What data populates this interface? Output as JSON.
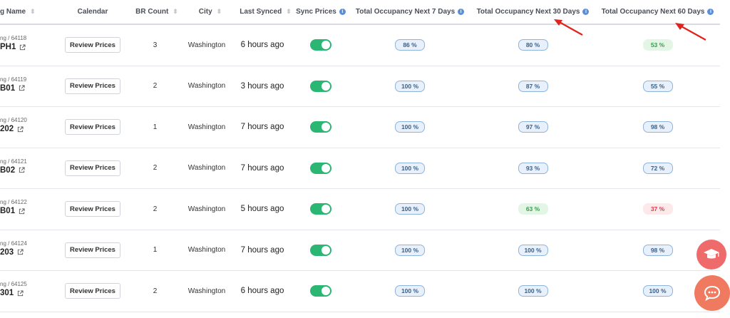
{
  "header": {
    "name": "g Name",
    "calendar": "Calendar",
    "br_count": "BR Count",
    "city": "City",
    "last_synced": "Last Synced",
    "sync_prices": "Sync Prices",
    "occ7": "Total Occupancy Next 7 Days",
    "occ30": "Total Occupancy Next 30 Days",
    "occ60": "Total Occupancy Next 60 Days"
  },
  "review_label": "Review Prices",
  "rows": [
    {
      "sub": "ng / 64118",
      "name": "PH1",
      "br": "3",
      "city": "Washington",
      "synced": "6 hours ago",
      "occ7": "86 %",
      "occ7_tone": "blue",
      "occ30": "80 %",
      "occ30_tone": "blue",
      "occ60": "53 %",
      "occ60_tone": "green"
    },
    {
      "sub": "ng / 64119",
      "name": "B01",
      "br": "2",
      "city": "Washington",
      "synced": "3 hours ago",
      "occ7": "100 %",
      "occ7_tone": "blue",
      "occ30": "87 %",
      "occ30_tone": "blue",
      "occ60": "55 %",
      "occ60_tone": "blue"
    },
    {
      "sub": "ng / 64120",
      "name": "202",
      "br": "1",
      "city": "Washington",
      "synced": "7 hours ago",
      "occ7": "100 %",
      "occ7_tone": "blue",
      "occ30": "97 %",
      "occ30_tone": "blue",
      "occ60": "98 %",
      "occ60_tone": "blue"
    },
    {
      "sub": "ng / 64121",
      "name": "B02",
      "br": "2",
      "city": "Washington",
      "synced": "7 hours ago",
      "occ7": "100 %",
      "occ7_tone": "blue",
      "occ30": "93 %",
      "occ30_tone": "blue",
      "occ60": "72 %",
      "occ60_tone": "blue"
    },
    {
      "sub": "ng / 64122",
      "name": "B01",
      "br": "2",
      "city": "Washington",
      "synced": "5 hours ago",
      "occ7": "100 %",
      "occ7_tone": "blue",
      "occ30": "63 %",
      "occ30_tone": "green",
      "occ60": "37 %",
      "occ60_tone": "red"
    },
    {
      "sub": "ng / 64124",
      "name": "203",
      "br": "1",
      "city": "Washington",
      "synced": "7 hours ago",
      "occ7": "100 %",
      "occ7_tone": "blue",
      "occ30": "100 %",
      "occ30_tone": "blue",
      "occ60": "98 %",
      "occ60_tone": "blue"
    },
    {
      "sub": "ng / 64125",
      "name": "301",
      "br": "2",
      "city": "Washington",
      "synced": "6 hours ago",
      "occ7": "100 %",
      "occ7_tone": "blue",
      "occ30": "100 %",
      "occ30_tone": "blue",
      "occ60": "100 %",
      "occ60_tone": "blue"
    }
  ],
  "colors": {
    "toggle_on": "#2bb673",
    "fab_academy": "#ef6b6b",
    "fab_chat": "#f07a5f",
    "annotation_arrow": "#e0231c"
  },
  "icons": [
    "external-link-icon",
    "sort-icon",
    "info-icon",
    "graduation-cap-icon",
    "chat-icon",
    "annotation-arrow"
  ]
}
